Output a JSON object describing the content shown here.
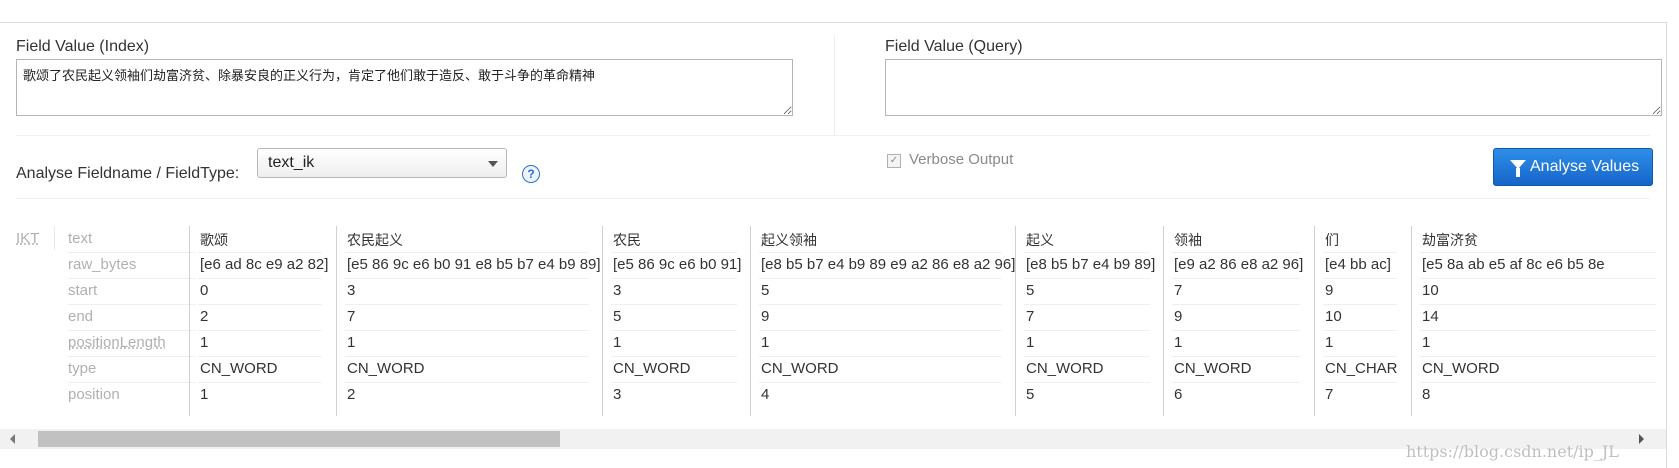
{
  "index_field": {
    "label": "Field Value (Index)",
    "value": "歌颂了农民起义领袖们劫富济贫、除暴安良的正义行为，肯定了他们敢于造反、敢于斗争的革命精神"
  },
  "query_field": {
    "label": "Field Value (Query)",
    "value": ""
  },
  "analyse": {
    "label": "Analyse Fieldname / FieldType:",
    "selected": "text_ik",
    "help": "?"
  },
  "verbose": {
    "label": "Verbose Output",
    "checked": true
  },
  "button": {
    "label": "Analyse Values",
    "icon": "funnel-icon",
    "color": "#1a73d6"
  },
  "result": {
    "analyzer_abbr": "IKT",
    "row_labels": [
      "text",
      "raw_bytes",
      "start",
      "end",
      "positionLength",
      "type",
      "position"
    ],
    "tokens": [
      {
        "text": "歌颂",
        "raw_bytes": "[e6 ad 8c e9 a2 82]",
        "start": "0",
        "end": "2",
        "positionLength": "1",
        "type": "CN_WORD",
        "position": "1"
      },
      {
        "text": "农民起义",
        "raw_bytes": "[e5 86 9c e6 b0 91 e8 b5 b7 e4 b9 89]",
        "start": "3",
        "end": "7",
        "positionLength": "1",
        "type": "CN_WORD",
        "position": "2"
      },
      {
        "text": "农民",
        "raw_bytes": "[e5 86 9c e6 b0 91]",
        "start": "3",
        "end": "5",
        "positionLength": "1",
        "type": "CN_WORD",
        "position": "3"
      },
      {
        "text": "起义领袖",
        "raw_bytes": "[e8 b5 b7 e4 b9 89 e9 a2 86 e8 a2 96]",
        "start": "5",
        "end": "9",
        "positionLength": "1",
        "type": "CN_WORD",
        "position": "4"
      },
      {
        "text": "起义",
        "raw_bytes": "[e8 b5 b7 e4 b9 89]",
        "start": "5",
        "end": "7",
        "positionLength": "1",
        "type": "CN_WORD",
        "position": "5"
      },
      {
        "text": "领袖",
        "raw_bytes": "[e9 a2 86 e8 a2 96]",
        "start": "7",
        "end": "9",
        "positionLength": "1",
        "type": "CN_WORD",
        "position": "6"
      },
      {
        "text": "们",
        "raw_bytes": "[e4 bb ac]",
        "start": "9",
        "end": "10",
        "positionLength": "1",
        "type": "CN_CHAR",
        "position": "7"
      },
      {
        "text": "劫富济贫",
        "raw_bytes": "[e5 8a ab e5 af 8c e6 b5 8e",
        "start": "10",
        "end": "14",
        "positionLength": "1",
        "type": "CN_WORD",
        "position": "8"
      }
    ]
  },
  "watermark": "https://blog.csdn.net/ip_JL"
}
